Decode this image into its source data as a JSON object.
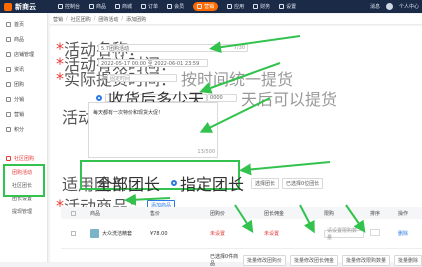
{
  "topbar": {
    "logo_text": "新商云",
    "nav": [
      {
        "label": "控制台"
      },
      {
        "label": "商品"
      },
      {
        "label": "商城"
      },
      {
        "label": "订单"
      },
      {
        "label": "会员"
      },
      {
        "label": "营销"
      },
      {
        "label": "应用"
      },
      {
        "label": "财务"
      },
      {
        "label": "设置"
      }
    ],
    "active_nav_index": 5,
    "right_items": [
      "消息",
      "个人中心"
    ]
  },
  "breadcrumb": [
    "营销",
    "社区团购",
    "团购活动",
    "添加团购"
  ],
  "sidebar": {
    "items": [
      {
        "label": "首页",
        "icon": "home-icon"
      },
      {
        "label": "商品",
        "icon": "goods-icon"
      },
      {
        "label": "店铺管理",
        "icon": "store-icon"
      },
      {
        "label": "资讯",
        "icon": "news-icon"
      },
      {
        "label": "团购",
        "icon": "group-icon"
      },
      {
        "label": "分销",
        "icon": "share-icon"
      },
      {
        "label": "营销",
        "icon": "marketing-icon"
      },
      {
        "label": "积分",
        "icon": "points-icon"
      },
      {
        "label": "社区团购",
        "icon": "community-icon"
      }
    ],
    "active_item": "社区团购",
    "sub_items": [
      "团购活动",
      "社区团长",
      "团长设置",
      "提现管理"
    ],
    "active_sub": "团购活动"
  },
  "form": {
    "activity_name_label": "活动名称：",
    "activity_name_value": "5.7团购活动",
    "activity_name_count": "7/30",
    "activity_time_label": "活动有效时间：",
    "activity_time_value": "2022-05-17 00:00  至  2022-06-01 23:59",
    "delivery_time_label": "实际提货时间：",
    "delivery_option1": "固定时间",
    "delivery_option1_desc": "按时间统一提货",
    "delivery_option2": "收货后多少天",
    "delivery_option2_value": "0000",
    "delivery_option2_desc": "天后可以提货",
    "notice_label": "活动公告：",
    "notice_text": "每天都有一次特价和现货大促！",
    "notice_count": "13/500",
    "scope_label": "适用团长：",
    "scope_option1": "全部团长",
    "scope_option2": "指定团长",
    "scope_btn": "选择团长",
    "scope_note": "已选择0位团长",
    "goods_label": "活动商品：",
    "add_goods_btn": "添加商品"
  },
  "table": {
    "headers": [
      "商品",
      "售价",
      "团购价",
      "团长佣金",
      "限购",
      "排序",
      "操作"
    ],
    "rows": [
      {
        "name": "大众洗洁精套",
        "price": "¥78.00",
        "group_price": "未设置",
        "commission": "未设置",
        "limit": "不限",
        "limit_placeholder": "请设置限购数量",
        "action": "删除"
      }
    ],
    "footer_label": "已选择0件商品",
    "footer_buttons": [
      "批量修改团购价",
      "批量修改团长佣金",
      "批量修改限购数量",
      "批量删除"
    ]
  },
  "colors": {
    "accent": "#2a7ae2",
    "highlight": "#33c24d",
    "danger": "#e53935",
    "topbar": "#1b2a47"
  }
}
